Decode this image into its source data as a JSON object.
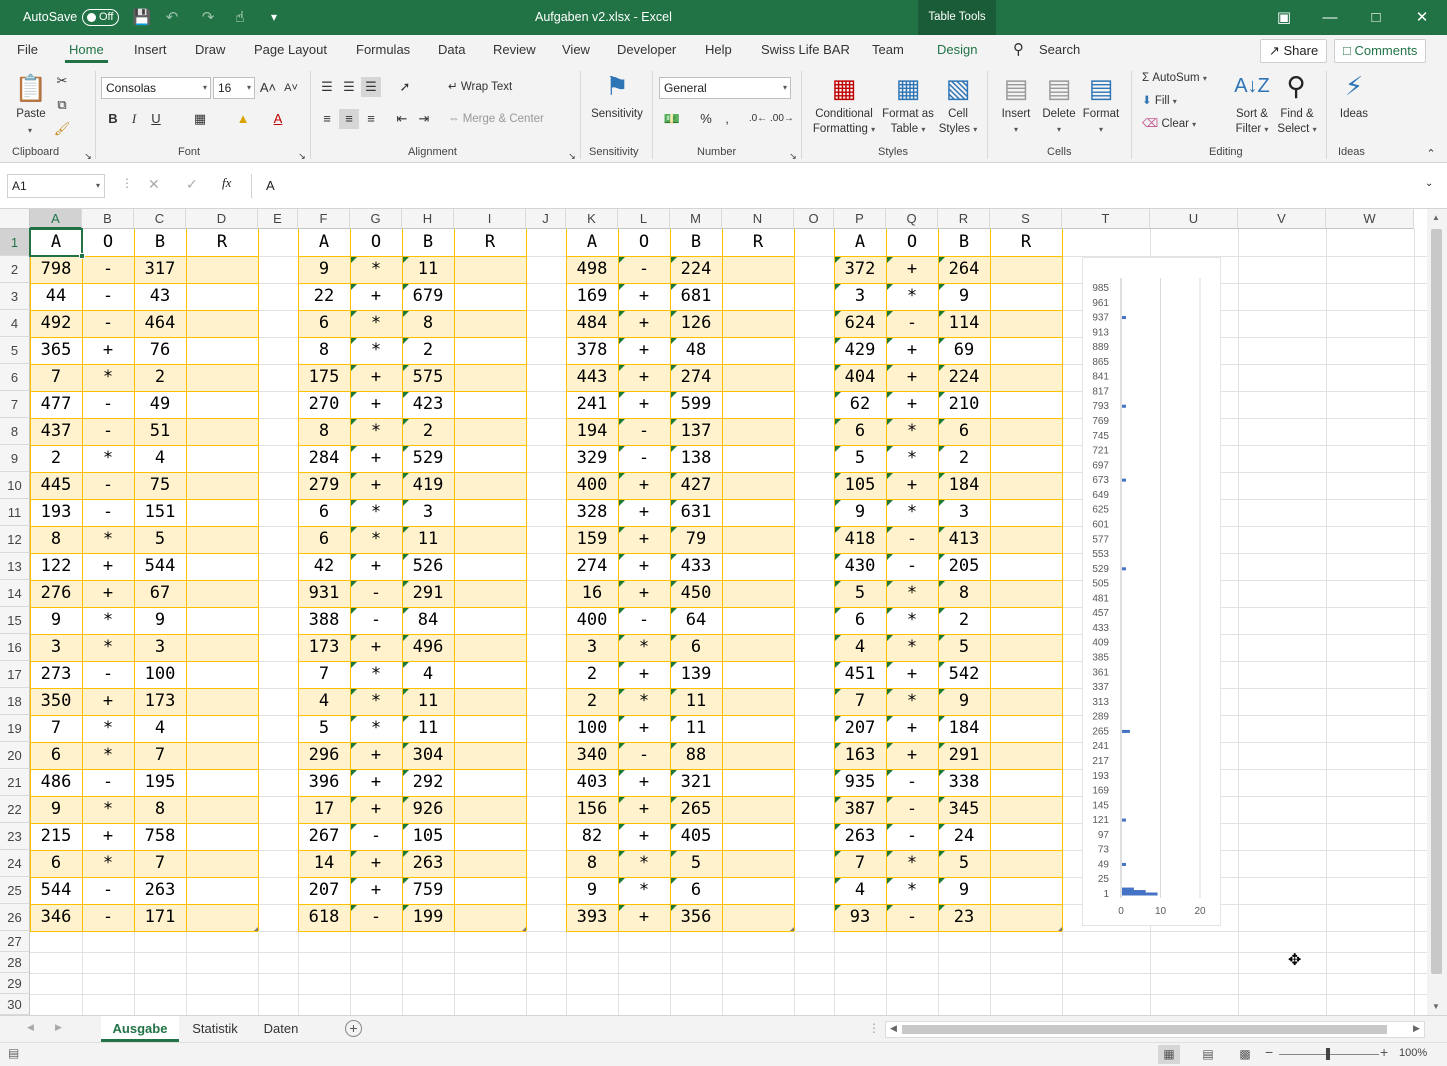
{
  "title_bar": {
    "autosave_label": "AutoSave",
    "autosave_state": "Off",
    "filename": "Aufgaben v2.xlsx  -  Excel",
    "contextual_tab": "Table Tools"
  },
  "ribbon_tabs": [
    "File",
    "Home",
    "Insert",
    "Draw",
    "Page Layout",
    "Formulas",
    "Data",
    "Review",
    "View",
    "Developer",
    "Help",
    "Swiss Life BAR",
    "Team",
    "Design"
  ],
  "active_tab": "Home",
  "search_label": "Search",
  "share_label": "Share",
  "comments_label": "Comments",
  "ribbon": {
    "clipboard": {
      "paste": "Paste",
      "group": "Clipboard"
    },
    "font": {
      "name": "Consolas",
      "size": "16",
      "group": "Font"
    },
    "alignment": {
      "wrap": "Wrap Text",
      "merge": "Merge & Center",
      "group": "Alignment"
    },
    "sensitivity": {
      "label": "Sensitivity",
      "group": "Sensitivity"
    },
    "number": {
      "format": "General",
      "group": "Number"
    },
    "styles": {
      "cond1": "Conditional",
      "cond2": "Formatting",
      "fmt1": "Format as",
      "fmt2": "Table",
      "cell1": "Cell",
      "cell2": "Styles",
      "group": "Styles"
    },
    "cells": {
      "insert": "Insert",
      "delete": "Delete",
      "format": "Format",
      "group": "Cells"
    },
    "editing": {
      "autosum": "AutoSum",
      "fill": "Fill",
      "clear": "Clear",
      "sort1": "Sort &",
      "sort2": "Filter",
      "find1": "Find &",
      "find2": "Select",
      "group": "Editing"
    },
    "ideas": {
      "label": "Ideas",
      "group": "Ideas"
    }
  },
  "formula_bar": {
    "name_box": "A1",
    "fx": "fx",
    "content": "A"
  },
  "columns": [
    "A",
    "B",
    "C",
    "D",
    "E",
    "F",
    "G",
    "H",
    "I",
    "J",
    "K",
    "L",
    "M",
    "N",
    "O",
    "P",
    "Q",
    "R",
    "S",
    "T",
    "U",
    "V",
    "W"
  ],
  "rows": [
    "1",
    "2",
    "3",
    "4",
    "5",
    "6",
    "7",
    "8",
    "9",
    "10",
    "11",
    "12",
    "13",
    "14",
    "15",
    "16",
    "17",
    "18",
    "19",
    "20",
    "21",
    "22",
    "23",
    "24",
    "25",
    "26",
    "27",
    "28",
    "29",
    "30"
  ],
  "headers": [
    "A",
    "O",
    "B",
    "R"
  ],
  "table1": [
    [
      "798",
      "-",
      "317"
    ],
    [
      "44",
      "-",
      "43"
    ],
    [
      "492",
      "-",
      "464"
    ],
    [
      "365",
      "+",
      "76"
    ],
    [
      "7",
      "*",
      "2"
    ],
    [
      "477",
      "-",
      "49"
    ],
    [
      "437",
      "-",
      "51"
    ],
    [
      "2",
      "*",
      "4"
    ],
    [
      "445",
      "-",
      "75"
    ],
    [
      "193",
      "-",
      "151"
    ],
    [
      "8",
      "*",
      "5"
    ],
    [
      "122",
      "+",
      "544"
    ],
    [
      "276",
      "+",
      "67"
    ],
    [
      "9",
      "*",
      "9"
    ],
    [
      "3",
      "*",
      "3"
    ],
    [
      "273",
      "-",
      "100"
    ],
    [
      "350",
      "+",
      "173"
    ],
    [
      "7",
      "*",
      "4"
    ],
    [
      "6",
      "*",
      "7"
    ],
    [
      "486",
      "-",
      "195"
    ],
    [
      "9",
      "*",
      "8"
    ],
    [
      "215",
      "+",
      "758"
    ],
    [
      "6",
      "*",
      "7"
    ],
    [
      "544",
      "-",
      "263"
    ],
    [
      "346",
      "-",
      "171"
    ]
  ],
  "table2": [
    [
      "9",
      "*",
      "11"
    ],
    [
      "22",
      "+",
      "679"
    ],
    [
      "6",
      "*",
      "8"
    ],
    [
      "8",
      "*",
      "2"
    ],
    [
      "175",
      "+",
      "575"
    ],
    [
      "270",
      "+",
      "423"
    ],
    [
      "8",
      "*",
      "2"
    ],
    [
      "284",
      "+",
      "529"
    ],
    [
      "279",
      "+",
      "419"
    ],
    [
      "6",
      "*",
      "3"
    ],
    [
      "6",
      "*",
      "11"
    ],
    [
      "42",
      "+",
      "526"
    ],
    [
      "931",
      "-",
      "291"
    ],
    [
      "388",
      "-",
      "84"
    ],
    [
      "173",
      "+",
      "496"
    ],
    [
      "7",
      "*",
      "4"
    ],
    [
      "4",
      "*",
      "11"
    ],
    [
      "5",
      "*",
      "11"
    ],
    [
      "296",
      "+",
      "304"
    ],
    [
      "396",
      "+",
      "292"
    ],
    [
      "17",
      "+",
      "926"
    ],
    [
      "267",
      "-",
      "105"
    ],
    [
      "14",
      "+",
      "263"
    ],
    [
      "207",
      "+",
      "759"
    ],
    [
      "618",
      "-",
      "199"
    ]
  ],
  "table3": [
    [
      "498",
      "-",
      "224"
    ],
    [
      "169",
      "+",
      "681"
    ],
    [
      "484",
      "+",
      "126"
    ],
    [
      "378",
      "+",
      "48"
    ],
    [
      "443",
      "+",
      "274"
    ],
    [
      "241",
      "+",
      "599"
    ],
    [
      "194",
      "-",
      "137"
    ],
    [
      "329",
      "-",
      "138"
    ],
    [
      "400",
      "+",
      "427"
    ],
    [
      "328",
      "+",
      "631"
    ],
    [
      "159",
      "+",
      "79"
    ],
    [
      "274",
      "+",
      "433"
    ],
    [
      "16",
      "+",
      "450"
    ],
    [
      "400",
      "-",
      "64"
    ],
    [
      "3",
      "*",
      "6"
    ],
    [
      "2",
      "+",
      "139"
    ],
    [
      "2",
      "*",
      "11"
    ],
    [
      "100",
      "+",
      "11"
    ],
    [
      "340",
      "-",
      "88"
    ],
    [
      "403",
      "+",
      "321"
    ],
    [
      "156",
      "+",
      "265"
    ],
    [
      "82",
      "+",
      "405"
    ],
    [
      "8",
      "*",
      "5"
    ],
    [
      "9",
      "*",
      "6"
    ],
    [
      "393",
      "+",
      "356"
    ]
  ],
  "table4": [
    [
      "372",
      "+",
      "264"
    ],
    [
      "3",
      "*",
      "9"
    ],
    [
      "624",
      "-",
      "114"
    ],
    [
      "429",
      "+",
      "69"
    ],
    [
      "404",
      "+",
      "224"
    ],
    [
      "62",
      "+",
      "210"
    ],
    [
      "6",
      "*",
      "6"
    ],
    [
      "5",
      "*",
      "2"
    ],
    [
      "105",
      "+",
      "184"
    ],
    [
      "9",
      "*",
      "3"
    ],
    [
      "418",
      "-",
      "413"
    ],
    [
      "430",
      "-",
      "205"
    ],
    [
      "5",
      "*",
      "8"
    ],
    [
      "6",
      "*",
      "2"
    ],
    [
      "4",
      "*",
      "5"
    ],
    [
      "451",
      "+",
      "542"
    ],
    [
      "7",
      "*",
      "9"
    ],
    [
      "207",
      "+",
      "184"
    ],
    [
      "163",
      "+",
      "291"
    ],
    [
      "935",
      "-",
      "338"
    ],
    [
      "387",
      "-",
      "345"
    ],
    [
      "263",
      "-",
      "24"
    ],
    [
      "7",
      "*",
      "5"
    ],
    [
      "4",
      "*",
      "9"
    ],
    [
      "93",
      "-",
      "23"
    ]
  ],
  "chart_data": {
    "type": "bar",
    "orientation": "horizontal",
    "title": "",
    "xlabel": "",
    "ylabel": "",
    "y_tick_labels": [
      "985",
      "961",
      "937",
      "913",
      "889",
      "865",
      "841",
      "817",
      "793",
      "769",
      "745",
      "721",
      "697",
      "673",
      "649",
      "625",
      "601",
      "577",
      "553",
      "529",
      "505",
      "481",
      "457",
      "433",
      "409",
      "385",
      "361",
      "337",
      "313",
      "289",
      "265",
      "241",
      "217",
      "193",
      "169",
      "145",
      "121",
      "97",
      "73",
      "49",
      "25",
      "1"
    ],
    "x_tick_labels": [
      "0",
      "10",
      "20"
    ],
    "xlim": [
      0,
      20
    ],
    "ylim": [
      1,
      985
    ],
    "series": [
      {
        "values_y": [
          1,
          5,
          9,
          937,
          793,
          673,
          529,
          265,
          121,
          49
        ],
        "values_x": [
          9,
          6,
          3,
          1,
          1,
          1,
          1,
          2,
          1,
          1
        ]
      }
    ],
    "color": "#4472c4"
  },
  "sheet_tabs": [
    "Ausgabe",
    "Statistik",
    "Daten"
  ],
  "active_sheet": "Ausgabe",
  "zoom": "100%",
  "colors": {
    "excel_green": "#217346",
    "band_fill": "#fff2cc",
    "border": "#ffc000"
  }
}
